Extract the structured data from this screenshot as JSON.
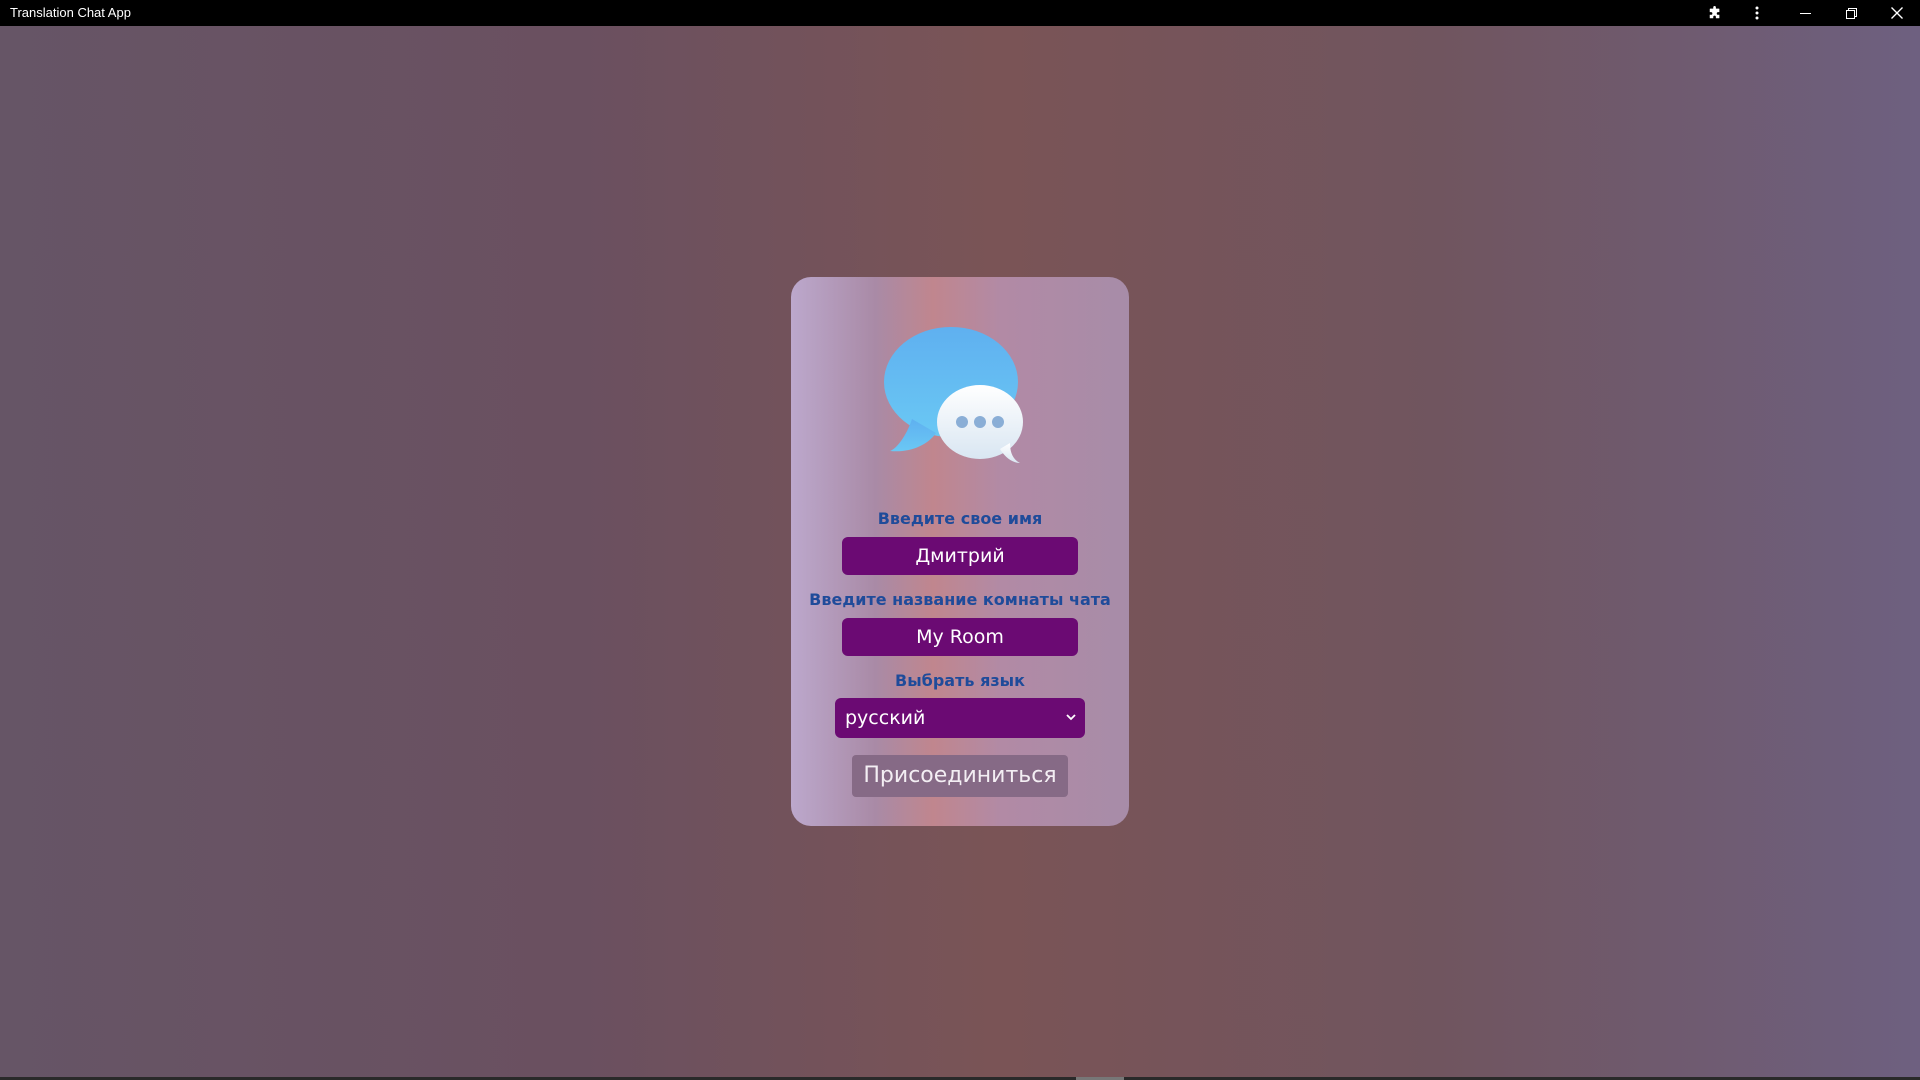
{
  "window": {
    "title": "Translation Chat App",
    "icons": {
      "extensions": "puzzle-icon",
      "menu": "more-vertical-icon",
      "minimize": "minimize-icon",
      "restore": "restore-icon",
      "close": "close-icon"
    }
  },
  "login": {
    "logo_icon": "chat-bubbles-icon",
    "name_label": "Введите свое имя",
    "name_value": "Дмитрий",
    "room_label": "Введите название комнаты чата",
    "room_value": "My Room",
    "language_label": "Выбрать язык",
    "language_selected": "русский",
    "join_label": "Присоединиться"
  },
  "colors": {
    "label_text": "#1f4b9a",
    "field_bg": "#6b0a73",
    "join_button_bg": "#866a86",
    "titlebar_bg": "#000000"
  }
}
